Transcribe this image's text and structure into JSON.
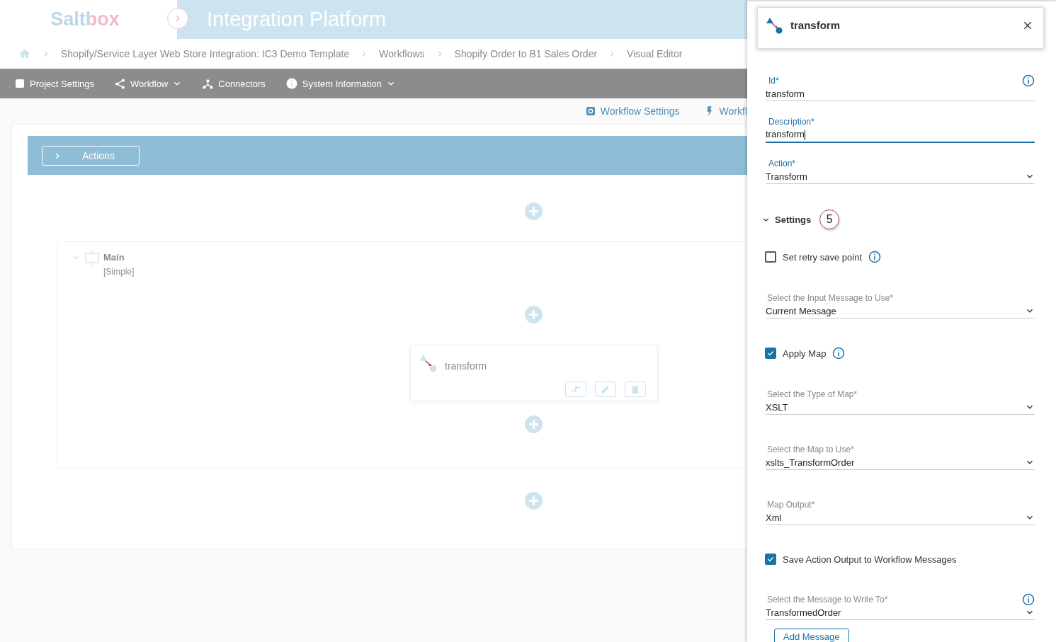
{
  "header": {
    "logo": "Saltbox",
    "title": "Integration Platform"
  },
  "breadcrumbs": [
    "Shopify/Service Layer Web Store Integration: IC3 Demo Template",
    "Workflows",
    "Shopify Order to B1 Sales Order",
    "Visual Editor"
  ],
  "nav": [
    {
      "label": "Project Settings",
      "dropdown": false
    },
    {
      "label": "Workflow",
      "dropdown": true
    },
    {
      "label": "Connectors",
      "dropdown": false
    },
    {
      "label": "System Information",
      "dropdown": true
    }
  ],
  "toolbar": [
    {
      "label": "Workflow Settings"
    },
    {
      "label": "Workfl"
    }
  ],
  "actions_bar": {
    "label": "Actions"
  },
  "canvas": {
    "group": {
      "title": "Main",
      "subtitle": "[Simple]",
      "expanded": true
    },
    "action": {
      "label": "transform"
    }
  },
  "panel": {
    "title": "transform",
    "fields": [
      {
        "kind": "text",
        "label": "Id*",
        "value": "transform",
        "focused": false,
        "info": true
      },
      {
        "kind": "text",
        "label": "Description*",
        "value": "transform",
        "focused": true,
        "info": false
      },
      {
        "kind": "select",
        "label": "Action*",
        "value": "Transform",
        "focused": false,
        "info": false
      }
    ],
    "settings": {
      "label": "Settings",
      "expanded": true,
      "callout": "5",
      "items": [
        {
          "kind": "checkbox",
          "label": "Set retry save point",
          "checked": false,
          "info": true
        },
        {
          "kind": "select",
          "label": "Select the Input Message to Use*",
          "value": "Current Message",
          "info": false
        },
        {
          "kind": "checkbox",
          "label": "Apply Map",
          "checked": true,
          "info": true
        },
        {
          "kind": "select",
          "label": "Select the Type of Map*",
          "value": "XSLT",
          "info": false
        },
        {
          "kind": "select",
          "label": "Select the Map to Use*",
          "value": "xslts_TransformOrder",
          "info": false
        },
        {
          "kind": "select",
          "label": "Map Output*",
          "value": "Xml",
          "info": false
        },
        {
          "kind": "checkbox",
          "label": "Save Action Output to Workflow Messages",
          "checked": true,
          "info": false
        },
        {
          "kind": "select",
          "label": "Select the Message to Write To*",
          "value": "TransformedOrder",
          "info": true
        }
      ]
    },
    "button": "Add Message"
  }
}
